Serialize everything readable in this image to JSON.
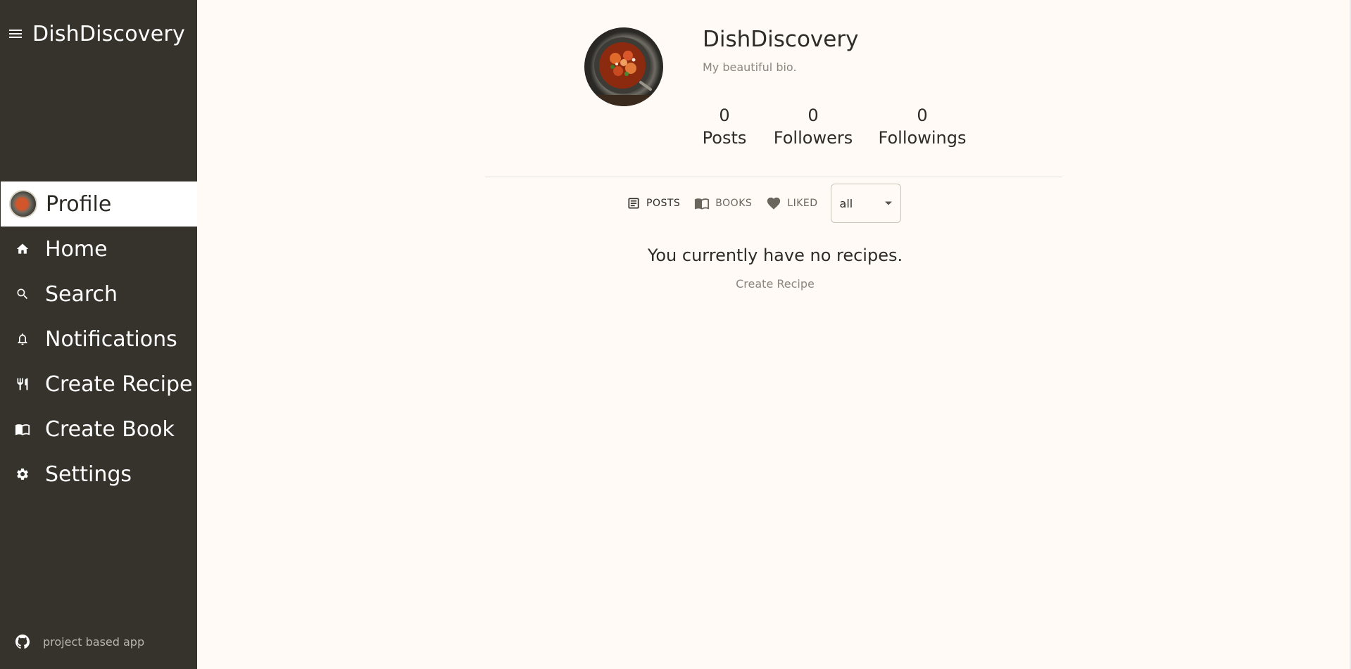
{
  "sidebar": {
    "brand": "DishDiscovery",
    "items": [
      {
        "label": "Profile",
        "icon": "avatar",
        "active": true
      },
      {
        "label": "Home",
        "icon": "home-icon"
      },
      {
        "label": "Search",
        "icon": "search-icon"
      },
      {
        "label": "Notifications",
        "icon": "bell-icon"
      },
      {
        "label": "Create Recipe",
        "icon": "restaurant-icon"
      },
      {
        "label": "Create Book",
        "icon": "book-icon"
      },
      {
        "label": "Settings",
        "icon": "gear-icon"
      }
    ],
    "footer_text": "project based app",
    "footer_icon": "github-icon"
  },
  "profile": {
    "name": "DishDiscovery",
    "bio": "My beautiful bio.",
    "stats": {
      "posts": {
        "value": "0",
        "label": "Posts"
      },
      "followers": {
        "value": "0",
        "label": "Followers"
      },
      "followings": {
        "value": "0",
        "label": "Followings"
      }
    }
  },
  "tabs": {
    "posts": "POSTS",
    "books": "BOOKS",
    "liked": "LIKED",
    "active": "posts"
  },
  "filter": {
    "selected": "all"
  },
  "empty_state": {
    "message": "You currently have no recipes.",
    "link": "Create Recipe"
  },
  "colors": {
    "sidebar_bg": "#35332b",
    "page_bg": "#fffaf5",
    "active_item_bg": "#ffffff"
  }
}
